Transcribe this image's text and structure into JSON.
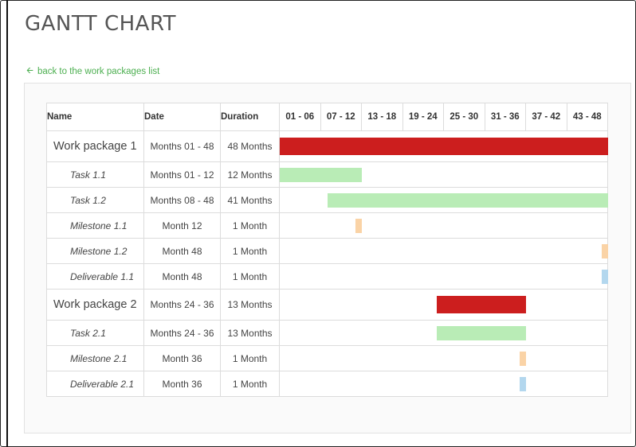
{
  "page": {
    "title": "GANTT CHART",
    "back_link": "back to the work packages list"
  },
  "colors": {
    "work_package": "#cc1e1e",
    "task": "#b9ecb6",
    "milestone": "#fad3a6",
    "deliverable": "#b3d7ee",
    "link": "#4caf50"
  },
  "table": {
    "headers": {
      "name": "Name",
      "date": "Date",
      "duration": "Duration"
    },
    "periods": [
      "01 - 06",
      "07 - 12",
      "13 - 18",
      "19 - 24",
      "25 - 30",
      "31 - 36",
      "37 - 42",
      "43 - 48"
    ],
    "total_months": 48,
    "rows": [
      {
        "kind": "work_package",
        "name": "Work package 1",
        "date": "Months 01 - 48",
        "duration": "48 Months",
        "start": 1,
        "end": 48
      },
      {
        "kind": "task",
        "name": "Task 1.1",
        "date": "Months 01 - 12",
        "duration": "12 Months",
        "start": 1,
        "end": 12
      },
      {
        "kind": "task",
        "name": "Task 1.2",
        "date": "Months 08 - 48",
        "duration": "41 Months",
        "start": 8,
        "end": 48
      },
      {
        "kind": "milestone",
        "name": "Milestone 1.1",
        "date": "Month 12",
        "duration": "1 Month",
        "start": 12,
        "end": 12
      },
      {
        "kind": "milestone",
        "name": "Milestone 1.2",
        "date": "Month 48",
        "duration": "1 Month",
        "start": 48,
        "end": 48
      },
      {
        "kind": "deliverable",
        "name": "Deliverable 1.1",
        "date": "Month 48",
        "duration": "1 Month",
        "start": 48,
        "end": 48
      },
      {
        "kind": "work_package",
        "name": "Work package 2",
        "date": "Months 24 - 36",
        "duration": "13 Months",
        "start": 24,
        "end": 36
      },
      {
        "kind": "task",
        "name": "Task 2.1",
        "date": "Months 24 - 36",
        "duration": "13 Months",
        "start": 24,
        "end": 36
      },
      {
        "kind": "milestone",
        "name": "Milestone 2.1",
        "date": "Month 36",
        "duration": "1 Month",
        "start": 36,
        "end": 36
      },
      {
        "kind": "deliverable",
        "name": "Deliverable 2.1",
        "date": "Month 36",
        "duration": "1 Month",
        "start": 36,
        "end": 36
      }
    ]
  }
}
